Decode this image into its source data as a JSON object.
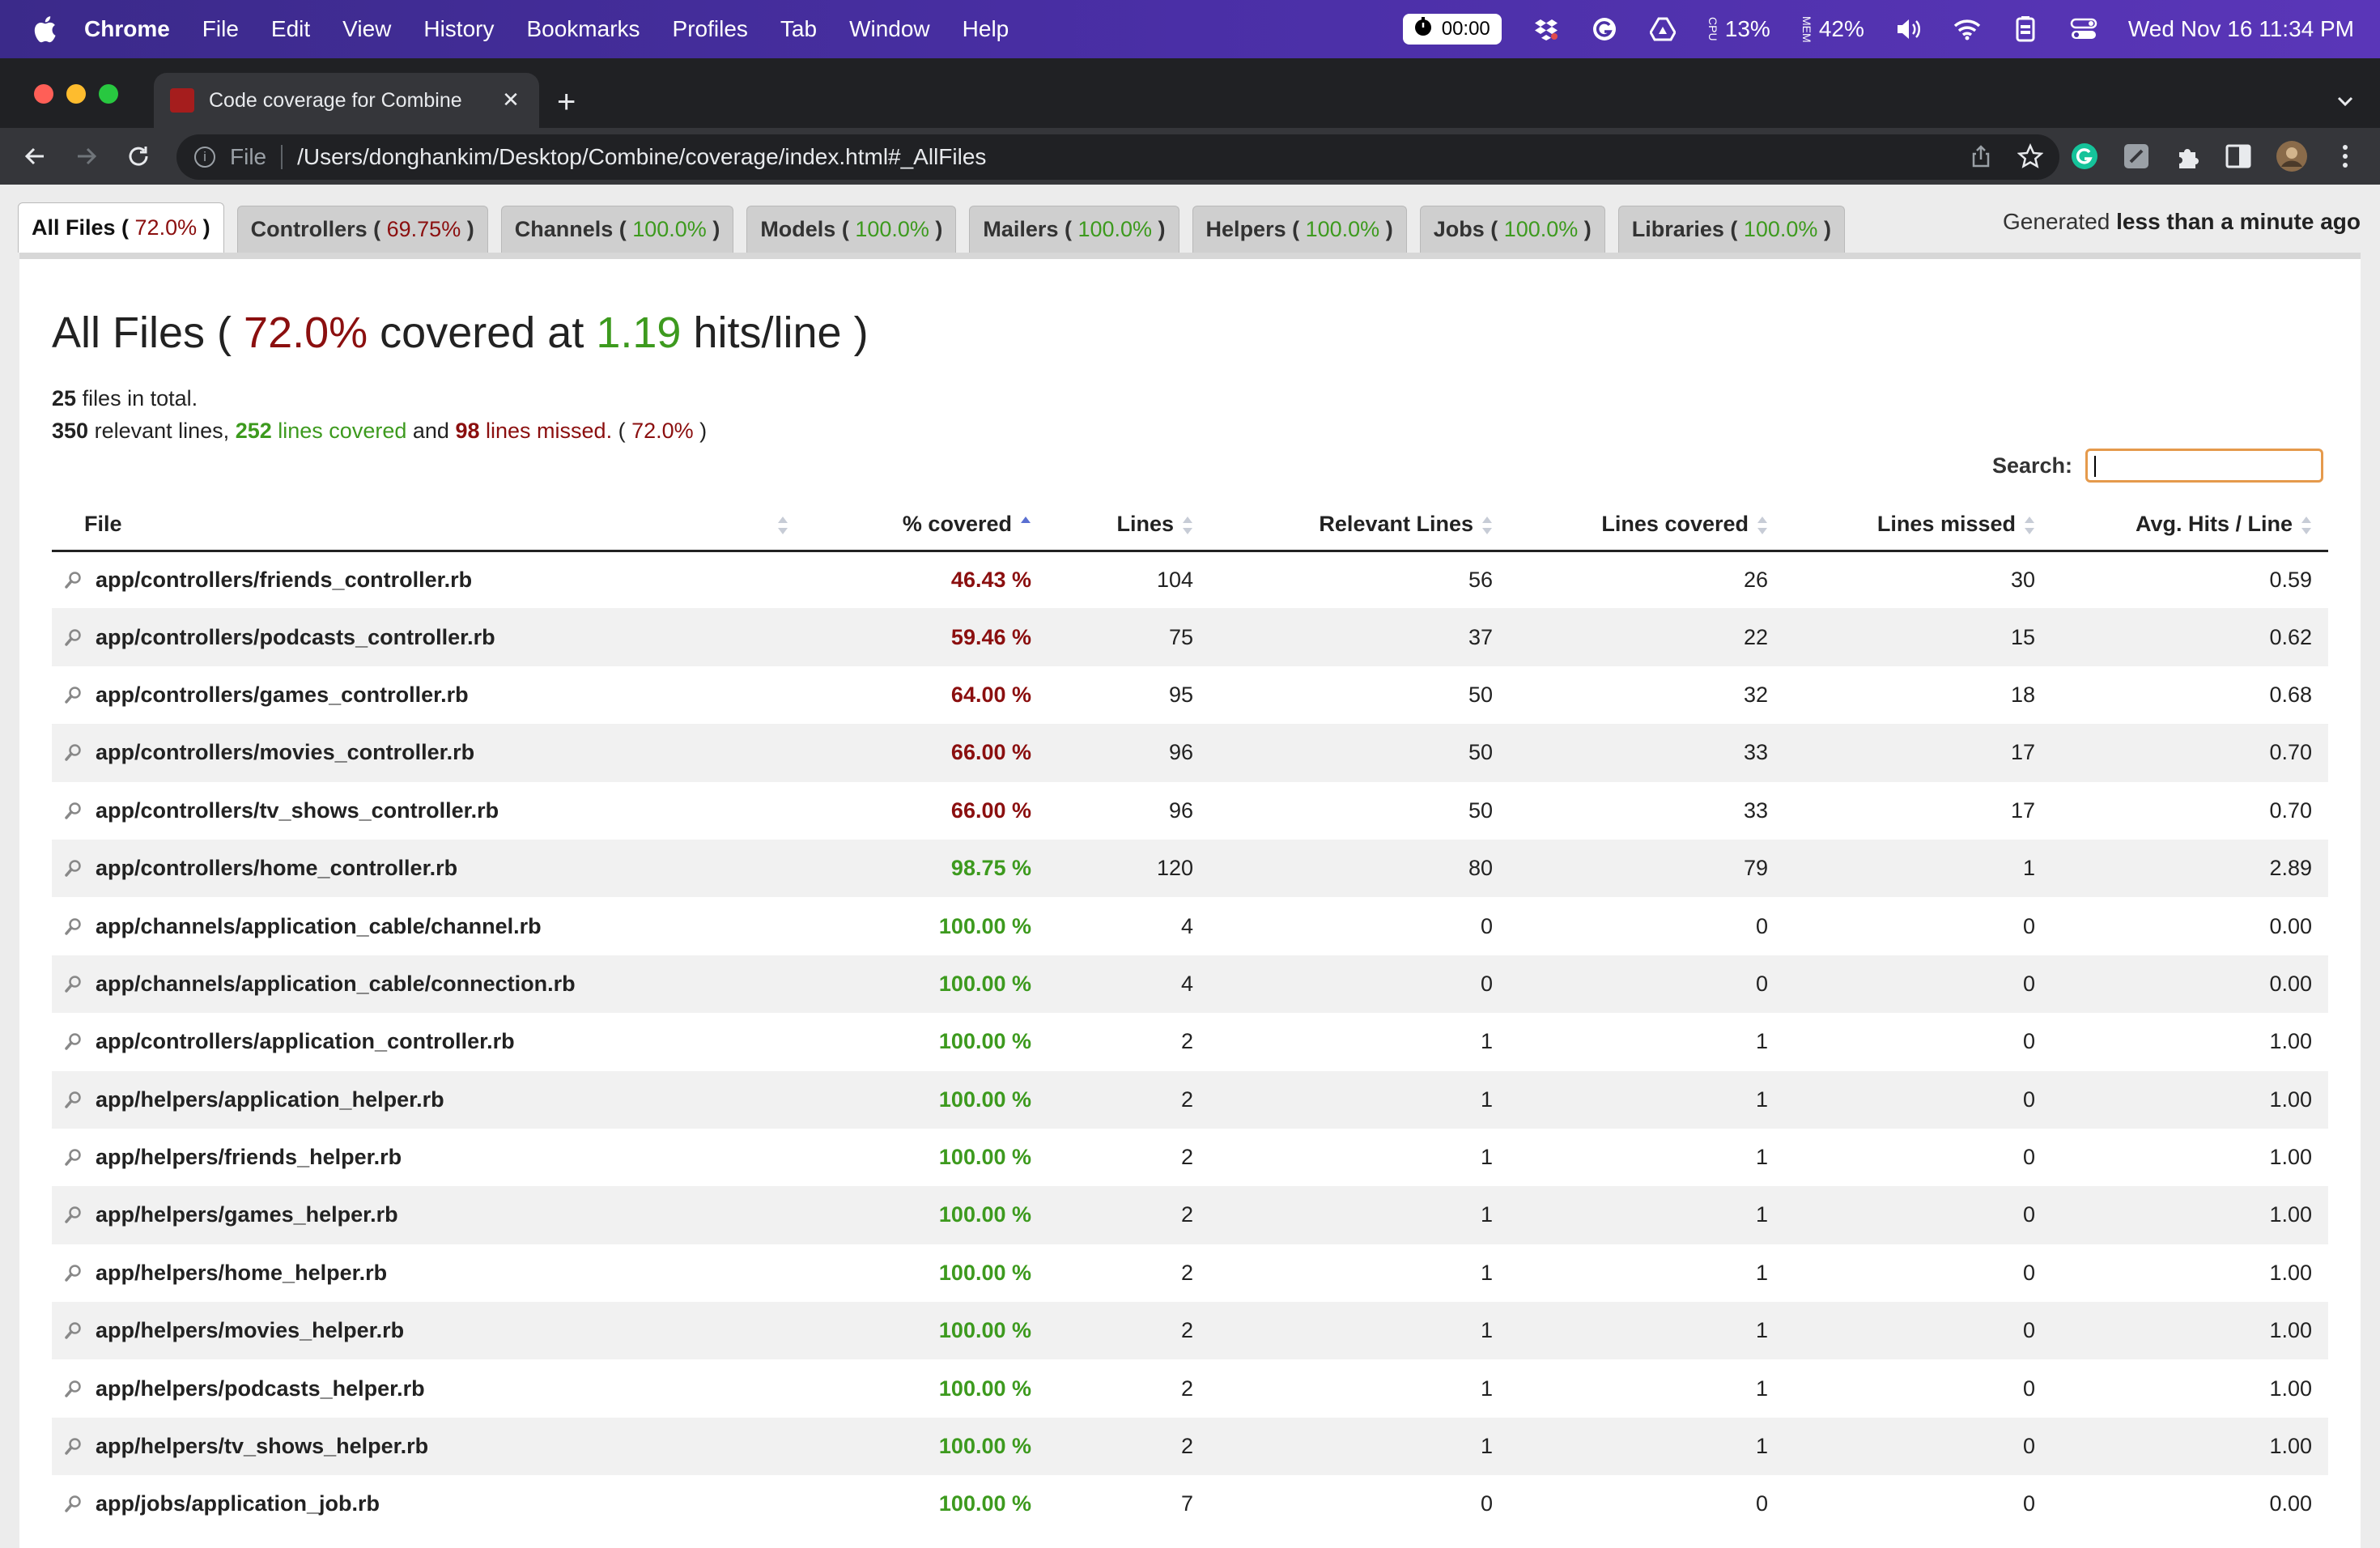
{
  "menubar": {
    "app": "Chrome",
    "items": [
      "File",
      "Edit",
      "View",
      "History",
      "Bookmarks",
      "Profiles",
      "Tab",
      "Window",
      "Help"
    ],
    "timer": "00:00",
    "cpu": "13%",
    "cpu_label": "CPU",
    "mem": "42%",
    "mem_label": "MEM",
    "clock": "Wed Nov 16  11:34 PM"
  },
  "browser": {
    "tab_title": "Code coverage for Combine",
    "url_scheme": "File",
    "url": "/Users/donghankim/Desktop/Combine/coverage/index.html#_AllFiles"
  },
  "colors": {
    "menubar": "#4a2fa6",
    "missed": "#8b0f0f",
    "covered": "#3d9a1e",
    "search_focus": "#e59a4c"
  },
  "nav_tabs": [
    {
      "name": "All Files",
      "pct": "72.0%",
      "status": "red",
      "active": true
    },
    {
      "name": "Controllers",
      "pct": "69.75%",
      "status": "red",
      "active": false
    },
    {
      "name": "Channels",
      "pct": "100.0%",
      "status": "green",
      "active": false
    },
    {
      "name": "Models",
      "pct": "100.0%",
      "status": "green",
      "active": false
    },
    {
      "name": "Mailers",
      "pct": "100.0%",
      "status": "green",
      "active": false
    },
    {
      "name": "Helpers",
      "pct": "100.0%",
      "status": "green",
      "active": false
    },
    {
      "name": "Jobs",
      "pct": "100.0%",
      "status": "green",
      "active": false
    },
    {
      "name": "Libraries",
      "pct": "100.0%",
      "status": "green",
      "active": false
    }
  ],
  "generated": {
    "prefix": "Generated",
    "value": "less than a minute ago"
  },
  "heading": {
    "title": "All Files",
    "coverage": "72.0%",
    "mid": "covered at",
    "hits": "1.19",
    "suffix": "hits/line"
  },
  "summary": {
    "files": "25",
    "files_text": "files in total.",
    "relevant": "350",
    "relevant_text": "relevant lines,",
    "covered": "252",
    "covered_text": "lines covered",
    "and_text": "and",
    "missed": "98",
    "missed_text": "lines missed.",
    "pct": "72.0%"
  },
  "search": {
    "label": "Search:",
    "value": ""
  },
  "table": {
    "headers": [
      "File",
      "% covered",
      "Lines",
      "Relevant Lines",
      "Lines covered",
      "Lines missed",
      "Avg. Hits / Line"
    ],
    "rows": [
      {
        "file": "app/controllers/friends_controller.rb",
        "pct": "46.43 %",
        "status": "red",
        "lines": "104",
        "relevant": "56",
        "covered": "26",
        "missed": "30",
        "avg": "0.59"
      },
      {
        "file": "app/controllers/podcasts_controller.rb",
        "pct": "59.46 %",
        "status": "red",
        "lines": "75",
        "relevant": "37",
        "covered": "22",
        "missed": "15",
        "avg": "0.62"
      },
      {
        "file": "app/controllers/games_controller.rb",
        "pct": "64.00 %",
        "status": "red",
        "lines": "95",
        "relevant": "50",
        "covered": "32",
        "missed": "18",
        "avg": "0.68"
      },
      {
        "file": "app/controllers/movies_controller.rb",
        "pct": "66.00 %",
        "status": "red",
        "lines": "96",
        "relevant": "50",
        "covered": "33",
        "missed": "17",
        "avg": "0.70"
      },
      {
        "file": "app/controllers/tv_shows_controller.rb",
        "pct": "66.00 %",
        "status": "red",
        "lines": "96",
        "relevant": "50",
        "covered": "33",
        "missed": "17",
        "avg": "0.70"
      },
      {
        "file": "app/controllers/home_controller.rb",
        "pct": "98.75 %",
        "status": "green",
        "lines": "120",
        "relevant": "80",
        "covered": "79",
        "missed": "1",
        "avg": "2.89"
      },
      {
        "file": "app/channels/application_cable/channel.rb",
        "pct": "100.00 %",
        "status": "green",
        "lines": "4",
        "relevant": "0",
        "covered": "0",
        "missed": "0",
        "avg": "0.00"
      },
      {
        "file": "app/channels/application_cable/connection.rb",
        "pct": "100.00 %",
        "status": "green",
        "lines": "4",
        "relevant": "0",
        "covered": "0",
        "missed": "0",
        "avg": "0.00"
      },
      {
        "file": "app/controllers/application_controller.rb",
        "pct": "100.00 %",
        "status": "green",
        "lines": "2",
        "relevant": "1",
        "covered": "1",
        "missed": "0",
        "avg": "1.00"
      },
      {
        "file": "app/helpers/application_helper.rb",
        "pct": "100.00 %",
        "status": "green",
        "lines": "2",
        "relevant": "1",
        "covered": "1",
        "missed": "0",
        "avg": "1.00"
      },
      {
        "file": "app/helpers/friends_helper.rb",
        "pct": "100.00 %",
        "status": "green",
        "lines": "2",
        "relevant": "1",
        "covered": "1",
        "missed": "0",
        "avg": "1.00"
      },
      {
        "file": "app/helpers/games_helper.rb",
        "pct": "100.00 %",
        "status": "green",
        "lines": "2",
        "relevant": "1",
        "covered": "1",
        "missed": "0",
        "avg": "1.00"
      },
      {
        "file": "app/helpers/home_helper.rb",
        "pct": "100.00 %",
        "status": "green",
        "lines": "2",
        "relevant": "1",
        "covered": "1",
        "missed": "0",
        "avg": "1.00"
      },
      {
        "file": "app/helpers/movies_helper.rb",
        "pct": "100.00 %",
        "status": "green",
        "lines": "2",
        "relevant": "1",
        "covered": "1",
        "missed": "0",
        "avg": "1.00"
      },
      {
        "file": "app/helpers/podcasts_helper.rb",
        "pct": "100.00 %",
        "status": "green",
        "lines": "2",
        "relevant": "1",
        "covered": "1",
        "missed": "0",
        "avg": "1.00"
      },
      {
        "file": "app/helpers/tv_shows_helper.rb",
        "pct": "100.00 %",
        "status": "green",
        "lines": "2",
        "relevant": "1",
        "covered": "1",
        "missed": "0",
        "avg": "1.00"
      },
      {
        "file": "app/jobs/application_job.rb",
        "pct": "100.00 %",
        "status": "green",
        "lines": "7",
        "relevant": "0",
        "covered": "0",
        "missed": "0",
        "avg": "0.00"
      }
    ]
  }
}
